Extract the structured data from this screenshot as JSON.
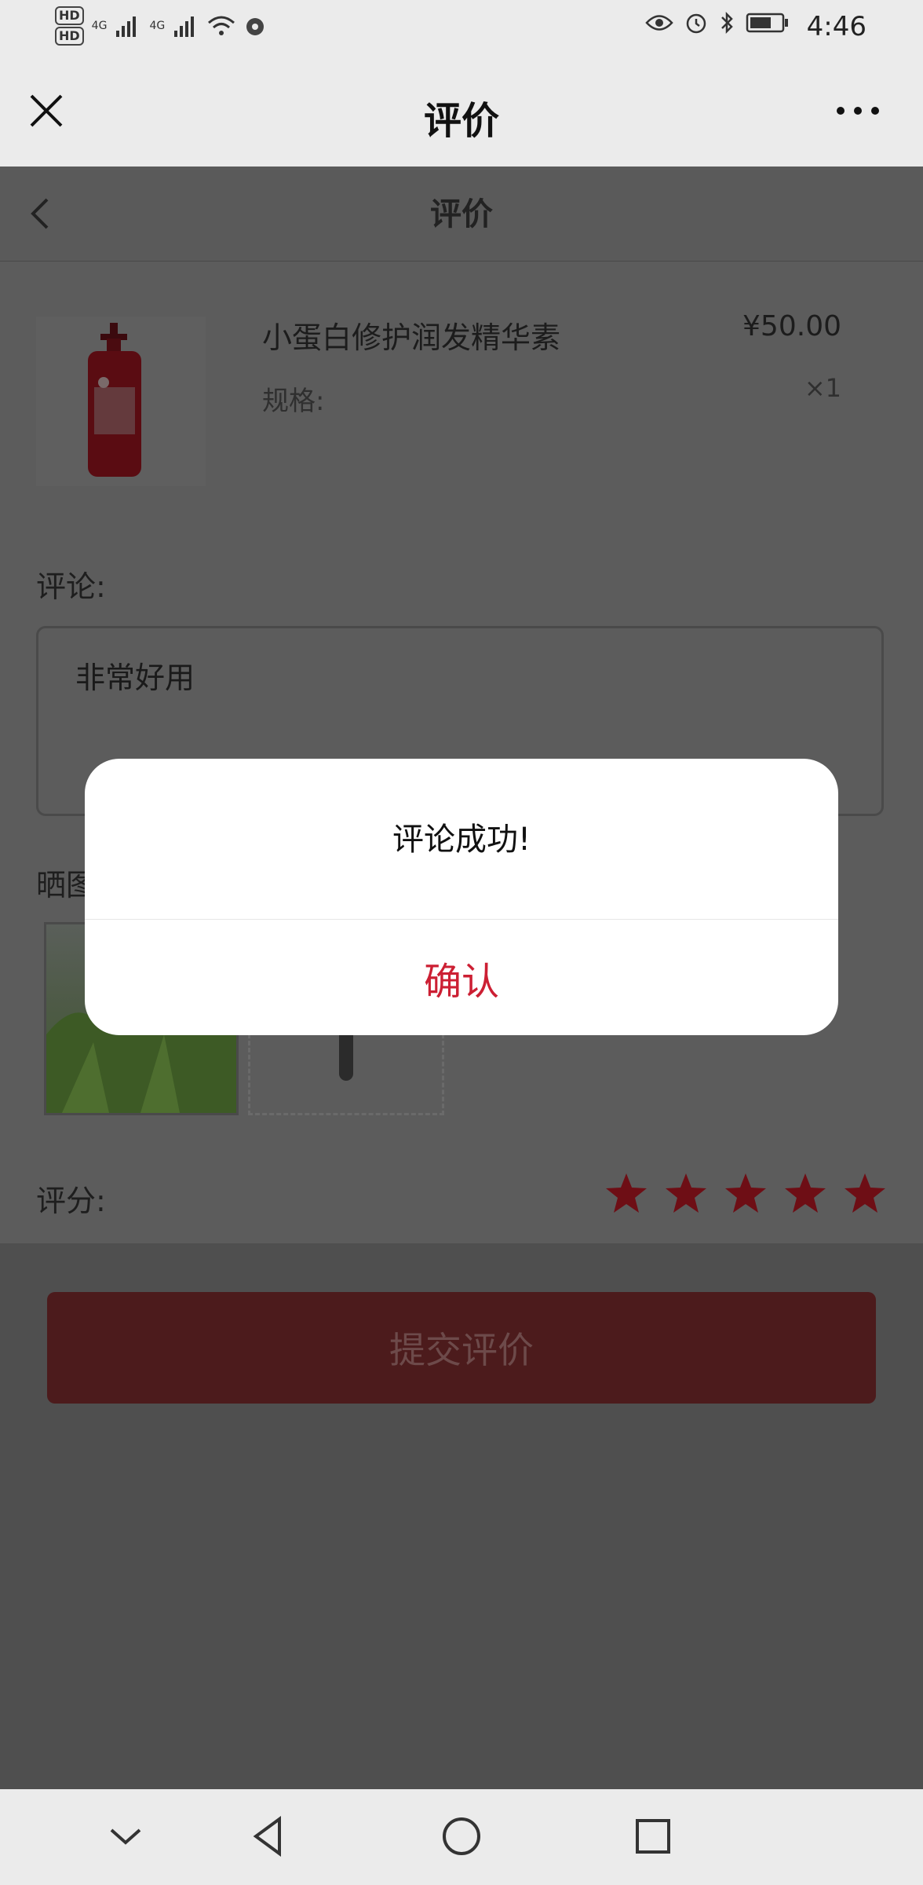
{
  "status_bar": {
    "hd1": "HD",
    "hd2": "HD",
    "sig1": "4G",
    "sig2": "4G",
    "time": "4:46"
  },
  "wechat_bar": {
    "title": "评价"
  },
  "page": {
    "title": "评价"
  },
  "product": {
    "name": "小蛋白修护润发精华素",
    "spec_label": "规格:",
    "price": "¥50.00",
    "quantity": "×1"
  },
  "review": {
    "comment_label": "评论:",
    "comment_text": "非常好用",
    "photo_label": "晒图",
    "rating_label": "评分:",
    "rating_value": 5,
    "rating_max": 5
  },
  "submit": {
    "label": "提交评价"
  },
  "dialog": {
    "message": "评论成功!",
    "confirm_label": "确认"
  },
  "colors": {
    "accent": "#cc1f33",
    "star_dimmed": "#6e0e15",
    "submit_dimmed": "#4c1b1c"
  }
}
